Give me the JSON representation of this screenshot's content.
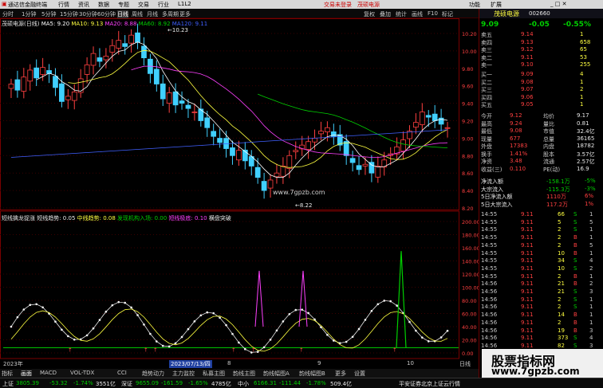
{
  "app": {
    "title": "通达信金融终端",
    "menus": [
      "行情",
      "资讯",
      "数据",
      "专题",
      "交易",
      "行业",
      "L1L2"
    ],
    "headline": "交易未登录",
    "headline2": "茂硕电源",
    "right_menus": [
      "功能",
      "扩展"
    ]
  },
  "toolbar": {
    "periods": [
      "分时",
      "1分钟",
      "5分钟",
      "15分钟",
      "30分钟",
      "60分钟",
      "日线",
      "周线",
      "月线",
      "多周期",
      "更多"
    ],
    "right_items": [
      "复权",
      "叠加",
      "统计",
      "画线",
      "F10",
      "标记"
    ]
  },
  "chart": {
    "stock_label": "茂硕电源(日线)",
    "ma_labels": [
      {
        "text": "MA5: 9.20",
        "color": "#ffffff"
      },
      {
        "text": "MA10: 9.13",
        "color": "#ffff40"
      },
      {
        "text": "MA20: 8.88",
        "color": "#ff40ff"
      },
      {
        "text": "MA60: 8.92",
        "color": "#00d000"
      },
      {
        "text": "MA120: 9.11",
        "color": "#4060ff"
      }
    ],
    "high_label": "10.23",
    "low_label": "8.22",
    "watermark": "www.7gpzb.com",
    "price_axis": [
      "10.20",
      "10.00",
      "9.80",
      "9.60",
      "9.40",
      "9.20",
      "9.00",
      "8.80",
      "8.60",
      "8.40",
      "8.20"
    ],
    "indicator_header": [
      {
        "text": "短线擒龙捉涨  短线趋势: 0.05",
        "color": "#e8e8e8"
      },
      {
        "text": "中线趋势: 0.08",
        "color": "#ffff40"
      },
      {
        "text": "发现机构入场: 0.00",
        "color": "#00d000"
      },
      {
        "text": "短线极底: 0.10",
        "color": "#ff40ff"
      },
      {
        "text": "横盘突破",
        "color": "#e8e8e8"
      }
    ],
    "indicator_axis": [
      "200.00",
      "180.00",
      "160.00",
      "140.00",
      "120.00",
      "100.00",
      "80.00",
      "60.00",
      "40.00",
      "20.00",
      "0.00"
    ],
    "date_labels": [
      "2023年",
      "2023/07/13/四",
      "8",
      "9",
      "10"
    ],
    "date_right": "日线"
  },
  "chart_data": {
    "type": "line",
    "title": "茂硕电源(日线)",
    "series": [
      {
        "name": "MA5",
        "color": "#ffffff"
      },
      {
        "name": "MA10",
        "color": "#ffff40"
      },
      {
        "name": "MA20",
        "color": "#ff40ff"
      },
      {
        "name": "MA60",
        "color": "#00d000"
      },
      {
        "name": "MA120",
        "color": "#4060ff"
      }
    ],
    "ylim": [
      8.2,
      10.3
    ],
    "closes": [
      9.62,
      9.55,
      9.7,
      9.78,
      9.69,
      9.81,
      9.74,
      9.58,
      9.42,
      9.48,
      9.53,
      9.68,
      9.84,
      9.97,
      9.88,
      9.94,
      10.06,
      10.12,
      10.05,
      10.18,
      10.1,
      9.92,
      9.74,
      9.62,
      9.45,
      9.52,
      9.38,
      9.4,
      9.34,
      9.3,
      9.2,
      9.12,
      9.02,
      8.95,
      8.88,
      8.8,
      8.86,
      8.74,
      8.68,
      8.55,
      8.4,
      8.52,
      8.6,
      8.68,
      8.8,
      8.86,
      8.92,
      8.96,
      9.0,
      9.08,
      9.12,
      9.02,
      8.92,
      8.8,
      8.72,
      8.64,
      8.7,
      8.6,
      8.68,
      8.75,
      8.82,
      8.9,
      8.98,
      9.08,
      9.18,
      9.3,
      9.24,
      9.2,
      9.16,
      9.12
    ]
  },
  "quote": {
    "name": "茂硕电源",
    "code": "002660",
    "price": "9.09",
    "change": "-0.05",
    "pct": "-0.55%",
    "asks": [
      {
        "label": "卖五",
        "price": "9.14",
        "vol": "1"
      },
      {
        "label": "卖四",
        "price": "9.13",
        "vol": "658"
      },
      {
        "label": "卖三",
        "price": "9.12",
        "vol": "65"
      },
      {
        "label": "卖二",
        "price": "9.11",
        "vol": "53"
      },
      {
        "label": "卖一",
        "price": "9.10",
        "vol": "255"
      }
    ],
    "bids": [
      {
        "label": "买一",
        "price": "9.09",
        "vol": "4"
      },
      {
        "label": "买二",
        "price": "9.08",
        "vol": "1"
      },
      {
        "label": "买三",
        "price": "9.07",
        "vol": "2"
      },
      {
        "label": "买四",
        "price": "9.06",
        "vol": "1"
      },
      {
        "label": "买五",
        "price": "9.05",
        "vol": "1"
      }
    ],
    "stats": [
      {
        "l1": "今开",
        "v1": "9.12",
        "l2": "均价",
        "v2": "9.17"
      },
      {
        "l1": "最高",
        "v1": "9.24",
        "l2": "量比",
        "v2": "0.81"
      },
      {
        "l1": "最低",
        "v1": "9.08",
        "l2": "市值",
        "v2": "32.4亿"
      },
      {
        "l1": "现量",
        "v1": "677",
        "l2": "总量",
        "v2": "36165"
      },
      {
        "l1": "外盘",
        "v1": "17383",
        "l2": "内盘",
        "v2": "18782"
      },
      {
        "l1": "换手",
        "v1": "1.41%",
        "l2": "股本",
        "v2": "3.57亿"
      },
      {
        "l1": "净资",
        "v1": "3.48",
        "l2": "流通",
        "v2": "2.57亿"
      },
      {
        "l1": "收益(三)",
        "v1": "0.110",
        "l2": "PE(动)",
        "v2": "16.9"
      }
    ],
    "flows": [
      {
        "label": "净流入额",
        "value": "-158.1万",
        "pct": "-5%"
      },
      {
        "label": "大宗流入",
        "value": "-115.3万",
        "pct": "-3%"
      },
      {
        "label": "5日净流入额",
        "value": "1110万",
        "pct": "6%"
      },
      {
        "label": "5日大宗流入",
        "value": "117.2万",
        "pct": "1%"
      }
    ],
    "ticks": [
      {
        "t": "14:55",
        "p": "9.11",
        "v": "66",
        "d": "S",
        "n": "1"
      },
      {
        "t": "14:55",
        "p": "9.11",
        "v": "5",
        "d": "S",
        "n": "5"
      },
      {
        "t": "14:55",
        "p": "9.11",
        "v": "2",
        "d": "S",
        "n": "1"
      },
      {
        "t": "14:55",
        "p": "9.11",
        "v": "2",
        "d": "B",
        "n": "1"
      },
      {
        "t": "14:55",
        "p": "9.11",
        "v": "2",
        "d": "B",
        "n": "5"
      },
      {
        "t": "14:55",
        "p": "9.11",
        "v": "10",
        "d": "B",
        "n": "1"
      },
      {
        "t": "14:55",
        "p": "9.11",
        "v": "34",
        "d": "S",
        "n": "4"
      },
      {
        "t": "14:55",
        "p": "9.11",
        "v": "10",
        "d": "S",
        "n": "2"
      },
      {
        "t": "14:55",
        "p": "9.11",
        "v": "2",
        "d": "B",
        "n": "1"
      },
      {
        "t": "14:56",
        "p": "9.11",
        "v": "21",
        "d": "B",
        "n": "2"
      },
      {
        "t": "14:56",
        "p": "9.11",
        "v": "21",
        "d": "S",
        "n": "3"
      },
      {
        "t": "14:56",
        "p": "9.11",
        "v": "2",
        "d": "S",
        "n": "1"
      },
      {
        "t": "14:56",
        "p": "9.11",
        "v": "2",
        "d": "S",
        "n": "1"
      },
      {
        "t": "14:56",
        "p": "9.11",
        "v": "14",
        "d": "B",
        "n": "1"
      },
      {
        "t": "14:56",
        "p": "9.11",
        "v": "2",
        "d": "B",
        "n": "1"
      },
      {
        "t": "14:56",
        "p": "9.11",
        "v": "19",
        "d": "B",
        "n": "3"
      },
      {
        "t": "14:56",
        "p": "9.11",
        "v": "373",
        "d": "S",
        "n": "4"
      },
      {
        "t": "14:56",
        "p": "9.11",
        "v": "82",
        "d": "S",
        "n": "3"
      }
    ]
  },
  "tabs": [
    "指标",
    "画面",
    "MACD",
    "VOL-TDX",
    "CCI",
    "趋势动力",
    "主力监控",
    "私募主图",
    "韵线主图",
    "韵线幅图A",
    "韵线幅图B",
    "更多",
    "设置"
  ],
  "tabs2": [
    "扩展↑",
    "关联报价",
    "资金分布",
    "综合资讯",
    "行业资讯",
    "互动问答",
    "首页新功能说明"
  ],
  "status": {
    "sh_label": "上证",
    "sh_val": "3805.39",
    "sh_chg": "-53.32",
    "sh_pct": "-1.74%",
    "sh_amt": "3551亿",
    "sz_label": "深证",
    "sz_val": "9655.09",
    "sz_chg": "-161.59",
    "sz_pct": "-1.65%",
    "sz_amt": "4785亿",
    "zx_label": "中小",
    "zx_val": "6166.31",
    "zx_chg": "-111.44",
    "zx_pct": "-1.78%",
    "zx_amt": "509.4亿",
    "broker": "平安证券北京上证云行情"
  },
  "ad": {
    "line1": "股票指标网",
    "line2": "www.7gpzb.com"
  }
}
